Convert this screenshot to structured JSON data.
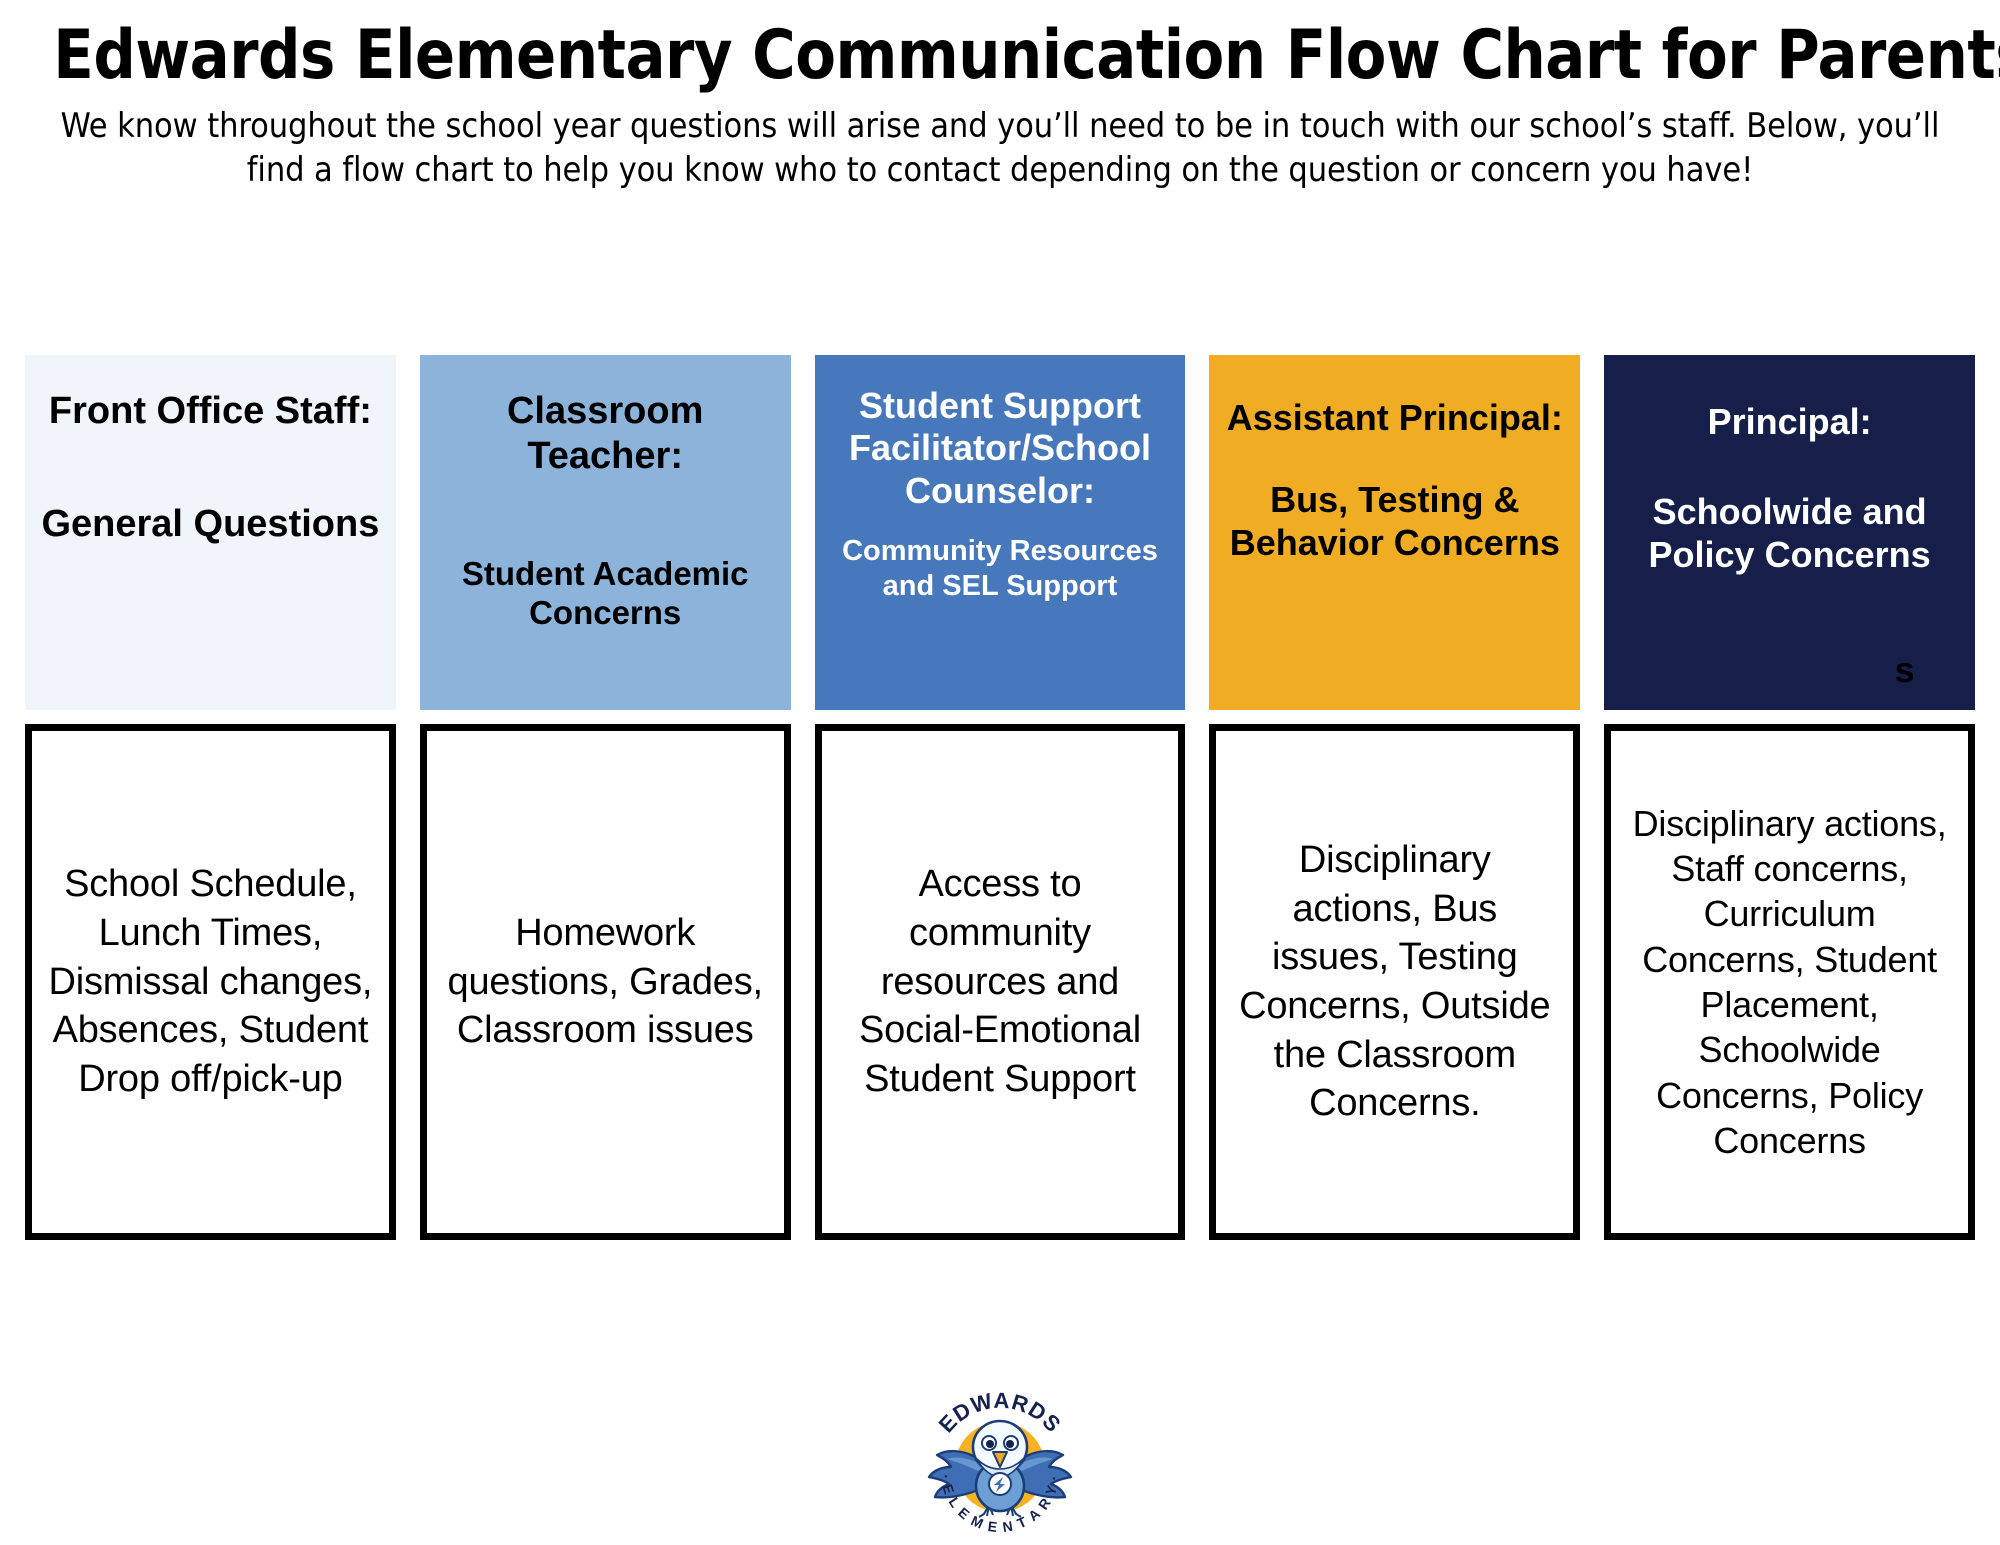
{
  "header": {
    "title": "Edwards Elementary Communication Flow Chart for Parents",
    "subtitle": "We know throughout the school year questions will arise and you’ll need to be in touch with our school’s staff. Below, you’ll find a flow chart to help you know who to contact depending on the question or concern you have!"
  },
  "colors": {
    "col1_bg": "#eff5fa",
    "col2_bg": "#8cb4db",
    "col3_bg": "#4678bb",
    "col4_bg": "#f0ad24",
    "col5_bg": "#161f4a",
    "box_border": "#000000",
    "text_dark": "#000000",
    "text_light": "#ffffff",
    "logo_yellow": "#f5b324",
    "logo_blue": "#2e5aa8"
  },
  "columns": [
    {
      "role": "Front Office Staff:",
      "scope": "General Questions",
      "details": "School Schedule, Lunch Times, Dismissal changes, Absences, Student Drop off/pick-up"
    },
    {
      "role": "Classroom Teacher:",
      "scope": "Student Academic Concerns",
      "details": "Homework questions, Grades, Classroom issues"
    },
    {
      "role": "Student Support Facilitator/School Counselor:",
      "scope": "Community Resources and SEL Support",
      "details": "Access to community resources and Social-Emotional Student Support"
    },
    {
      "role": "Assistant Principal:",
      "scope": "Bus, Testing & Behavior Concerns",
      "details": "Disciplinary actions, Bus issues, Testing Concerns, Outside the Classroom Concerns."
    },
    {
      "role": "Principal:",
      "scope": "Schoolwide and Policy Concerns",
      "scope_artifact": "s",
      "details": "Disciplinary actions, Staff concerns, Curriculum Concerns, Student Placement, Schoolwide Concerns, Policy Concerns"
    }
  ],
  "logo": {
    "top_text": "EDWARDS",
    "bottom_text": "ELEMENTARY",
    "mascot": "eagle"
  }
}
